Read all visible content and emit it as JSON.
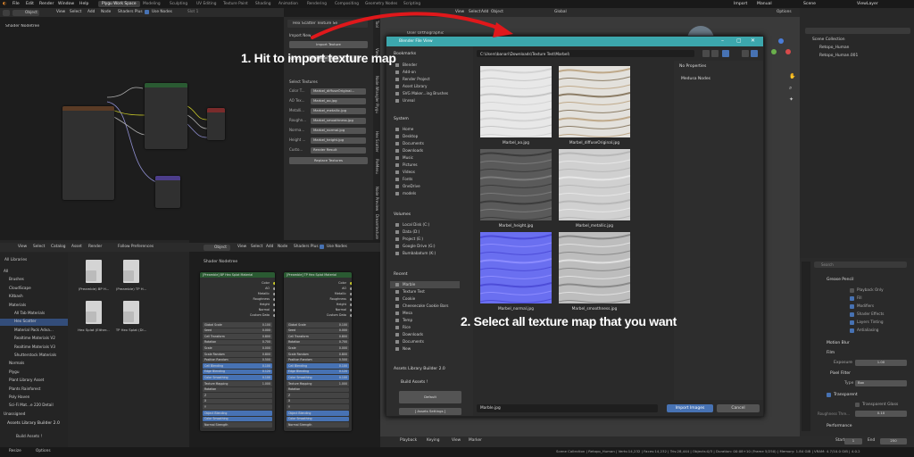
{
  "topbar": {
    "menus": [
      "File",
      "Edit",
      "Render",
      "Window",
      "Help"
    ],
    "workspaces": [
      "Plygu Work Space",
      "Modeling",
      "Sculpting",
      "UV Editing",
      "Texture Paint",
      "Shading",
      "Animation",
      "Rendering",
      "Compositing",
      "Geometry Nodes",
      "Scripting"
    ],
    "right": [
      "Import",
      "Manual",
      "Scene",
      "ViewLayer"
    ]
  },
  "node_editor_top": {
    "object_label": "Object",
    "menus": [
      "View",
      "Select",
      "Add",
      "Node",
      "Shaders Plus"
    ],
    "use_nodes": "Use Nodes",
    "slot": "Slot 1",
    "title": "Shader Nodetree"
  },
  "hex_panel": {
    "title": "Hex Scatter Texture Se",
    "import_new": "Import New",
    "import_button": "Import Texture",
    "node_label": "Node:",
    "node_value": "Hexagonal Tiling",
    "select_textures": "Select Textures",
    "fields": [
      {
        "label": "Color T...",
        "value": "Marbel_diffuseOriginal..."
      },
      {
        "label": "AO Tex...",
        "value": "Marbel_ao.jpg"
      },
      {
        "label": "Metalli...",
        "value": "Marbel_metallic.jpg"
      },
      {
        "label": "Roughn...",
        "value": "Marbel_smoothness.jpg"
      },
      {
        "label": "Norma...",
        "value": "Marbel_normal.jpg"
      },
      {
        "label": "Height ...",
        "value": "Marbel_height.jpg"
      },
      {
        "label": "Custo...",
        "value": "Render Result"
      }
    ],
    "replace_button": "Replace Textures",
    "side_tabs": [
      "Tool",
      "View",
      "Node Wrangler",
      "Plygu",
      "Hex Scatter",
      "PieMenu",
      "Node Preview",
      "Dreamtexture"
    ]
  },
  "viewport": {
    "mode": "Object",
    "menus": [
      "View",
      "Select",
      "Add",
      "Object"
    ],
    "global": "Global",
    "title": "User Orthographic",
    "options": "Options"
  },
  "outliner": {
    "search": "",
    "items": [
      "Scene Collection",
      "Retopo_Human",
      "Retopo_Human.001"
    ]
  },
  "properties": {
    "search_placeholder": "Search",
    "sections": [
      "Grease Pencil",
      "Motion Blur",
      "Film",
      "Pixel Filter",
      "Performance",
      "Bake"
    ],
    "gp_options": [
      "Playback Only",
      "Fill",
      "Modifiers",
      "Shader Effects",
      "Layers Tinting",
      "Antialiasing"
    ],
    "exposure_label": "Exposure",
    "exposure_value": "1.00",
    "type_label": "Type",
    "type_value": "Box",
    "transparent": "Transparent",
    "transparent_glass": "Transparent Glass",
    "roughness_label": "Roughness Thre...",
    "roughness_value": "0.10"
  },
  "asset_browser": {
    "menus": [
      "View",
      "Select",
      "Catalog",
      "Asset",
      "Render"
    ],
    "follow": "Follow Preferences",
    "library": "All Libraries",
    "tree": [
      {
        "label": "All",
        "depth": 0
      },
      {
        "label": "Brushes",
        "depth": 1
      },
      {
        "label": "CloudScape",
        "depth": 1
      },
      {
        "label": "Kitbash",
        "depth": 1
      },
      {
        "label": "Materials",
        "depth": 1
      },
      {
        "label": "All Tab Materials",
        "depth": 2
      },
      {
        "label": "Hex Scatter",
        "depth": 2,
        "selected": true
      },
      {
        "label": "Material Pack Adva...",
        "depth": 2
      },
      {
        "label": "Realtime Materials V2",
        "depth": 2
      },
      {
        "label": "Realtime Materials V3",
        "depth": 2
      },
      {
        "label": "Shutterstock Materials",
        "depth": 2
      },
      {
        "label": "Normals",
        "depth": 1
      },
      {
        "label": "Plygu",
        "depth": 1
      },
      {
        "label": "Plant Library Asset",
        "depth": 1
      },
      {
        "label": "Plants Rainforest",
        "depth": 1
      },
      {
        "label": "Poly Haven",
        "depth": 1
      },
      {
        "label": "Sci-Fi Mat...e 220 Detail",
        "depth": 1
      },
      {
        "label": "Unassigned",
        "depth": 0
      }
    ],
    "assets": [
      "(Preamble) BP H...",
      "(Preamble) TP H...",
      "Hex Splat (Either...",
      "TP Hex Splat (Di..."
    ],
    "builder_title": "Assets Library Builder 2.0",
    "builder_item": "Build Assets !"
  },
  "node_editor_bottom": {
    "object_label": "Object",
    "menus": [
      "View",
      "Select",
      "Add",
      "Node",
      "Shaders Plus"
    ],
    "use_nodes": "Use Nodes",
    "title": "Shader Nodetree",
    "node1_title": "[Preamble] BP Hex Splat Material",
    "node2_title": "[Preamble] TP Hex Splat Material",
    "outputs": [
      "Color",
      "AO",
      "Metallic",
      "Roughness",
      "Height",
      "Normal",
      "Custom Data"
    ],
    "inputs": [
      "Global Scale",
      "Seed",
      "Cell Transform",
      "Rotation",
      "Scale",
      "Scale Random",
      "Position Random",
      "Cell Blending",
      "Edge Blending",
      "Color Smoothing",
      "Texture Mapping",
      "Rotation",
      "Z",
      "X",
      "Y",
      "Object Blending",
      "Color Smoothing",
      "Normal Strength"
    ],
    "values": [
      "0.100",
      "0.000",
      "0.800",
      "0.700",
      "0.000",
      "0.800",
      "0.500",
      "0.100",
      "0.120",
      "0.100",
      "1.000"
    ]
  },
  "file_dialog": {
    "title": "Blender File View",
    "path": "C:\\Users\\banari\\Downloads\\Texture Test\\Marbel\\",
    "bookmarks_title": "Bookmarks",
    "bookmarks": [
      "Blender",
      "Add-on",
      "Render Project",
      "Asset Library",
      "SVG Maker...ing Brushes",
      "Unreal"
    ],
    "system_title": "System",
    "system": [
      "Home",
      "Desktop",
      "Documents",
      "Downloads",
      "Music",
      "Pictures",
      "Videos",
      "Fonts",
      "OneDrive",
      "models"
    ],
    "volumes_title": "Volumes",
    "volumes": [
      "Local Disk (C:)",
      "Data (D:)",
      "Project (E:)",
      "Google Drive (G:)",
      "Bumbabatum (K:)"
    ],
    "recent_title": "Recent",
    "recent": [
      "Marble",
      "Texture Test",
      "Cookie",
      "Cheesecake Cookie Bars",
      "Mesa",
      "Temp",
      "Rice",
      "Downloads",
      "Documents",
      "New"
    ],
    "builder_title": "Assets Library Builder 2.0",
    "builder_item": "Build Assets !",
    "default_button": "Default",
    "settings_button": "[ Assets Settings ]",
    "properties_label": "No Properties",
    "medusa": "Medusa Nodes",
    "files": [
      {
        "name": "Marbel_ao.jpg",
        "tex": "ao"
      },
      {
        "name": "Marbel_diffuseOriginal.jpg",
        "tex": "diffuse"
      },
      {
        "name": "Marbel_height.jpg",
        "tex": "height"
      },
      {
        "name": "Marbel_metallic.jpg",
        "tex": "metallic"
      },
      {
        "name": "Marbel_normal.jpg",
        "tex": "normal"
      },
      {
        "name": "Marbel_smoothness.jpg",
        "tex": "smoothness"
      }
    ],
    "filename": "Marble.jpg",
    "import_button": "Import Images",
    "cancel_button": "Cancel"
  },
  "timeline": {
    "menus": [
      "Playback",
      "Keying",
      "View",
      "Marker"
    ],
    "start_label": "Start",
    "start": "1",
    "end_label": "End",
    "end": "250",
    "frame": "5"
  },
  "statusbar": {
    "left": [
      "Resize",
      "Options"
    ],
    "right": "Scene Collection | Retopo_Human | Verts:14,232 | Faces:14,232 | Tris:28,444 | Objects:0/3 | Duration: 00:08+10 (Frame 5/250) | Memory: 1.84 GiB | VRAM: 4.7/10.0 GiB | 4.0.2"
  },
  "annotations": {
    "step1": "1. Hit to import texture map",
    "step2": "2. Select all texture map that you want"
  },
  "colors": {
    "accent": "#4772b3",
    "arrow": "#e0181b",
    "dialog_teal": "#3ca7ad"
  }
}
